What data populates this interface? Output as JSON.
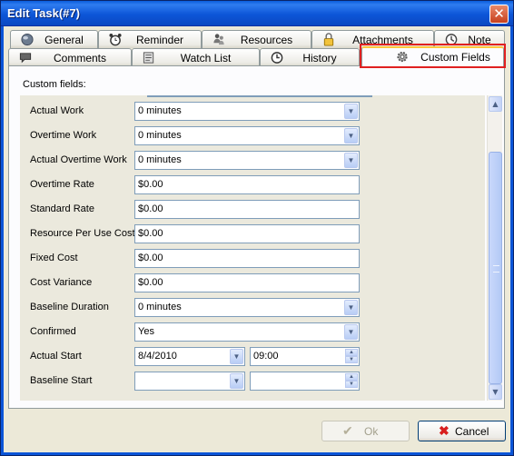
{
  "window": {
    "title": "Edit Task(#7)"
  },
  "tabs_row1": [
    {
      "label": "General",
      "icon": "globe-icon"
    },
    {
      "label": "Reminder",
      "icon": "alarm-clock-icon"
    },
    {
      "label": "Resources",
      "icon": "people-icon"
    },
    {
      "label": "Attachments",
      "icon": "paperclip-icon"
    },
    {
      "label": "Note",
      "icon": "note-icon"
    }
  ],
  "tabs_row2": [
    {
      "label": "Comments",
      "icon": "comments-icon"
    },
    {
      "label": "Watch List",
      "icon": "watch-list-icon"
    },
    {
      "label": "History",
      "icon": "history-icon"
    },
    {
      "label": "Custom Fields",
      "icon": "gear-icon",
      "active": true
    }
  ],
  "custom_fields": {
    "section_label": "Custom fields:",
    "rows": [
      {
        "label": "Actual Work",
        "value": "0 minutes",
        "kind": "dropdown"
      },
      {
        "label": "Overtime Work",
        "value": "0 minutes",
        "kind": "dropdown"
      },
      {
        "label": "Actual Overtime Work",
        "value": "0 minutes",
        "kind": "dropdown"
      },
      {
        "label": "Overtime Rate",
        "value": "$0.00",
        "kind": "text"
      },
      {
        "label": "Standard Rate",
        "value": "$0.00",
        "kind": "text"
      },
      {
        "label": "Resource Per Use Cost",
        "value": "$0.00",
        "kind": "text"
      },
      {
        "label": "Fixed Cost",
        "value": "$0.00",
        "kind": "text"
      },
      {
        "label": "Cost Variance",
        "value": "$0.00",
        "kind": "text"
      },
      {
        "label": "Baseline Duration",
        "value": "0 minutes",
        "kind": "dropdown"
      },
      {
        "label": "Confirmed",
        "value": "Yes",
        "kind": "dropdown"
      },
      {
        "label": "Actual Start",
        "date": "8/4/2010",
        "time": "09:00",
        "kind": "datetime"
      },
      {
        "label": "Baseline Start",
        "date": "",
        "time": "",
        "kind": "datetime"
      }
    ]
  },
  "footer": {
    "ok_label": "Ok",
    "cancel_label": "Cancel"
  },
  "colors": {
    "titlebar": "#0a5ddc",
    "highlight": "#e02020",
    "cancel_icon": "#d81e1e",
    "ok_icon": "#b5b09a"
  }
}
